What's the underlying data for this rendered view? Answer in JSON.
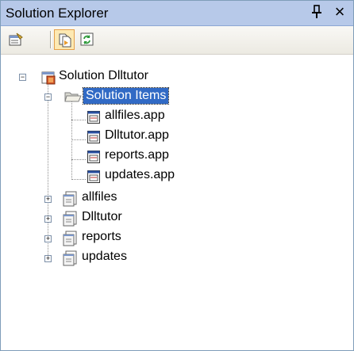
{
  "panel": {
    "title": "Solution Explorer",
    "pin_icon": "pin-icon",
    "close_icon": "close-icon",
    "close_glyph": "×",
    "pin_glyph": "ᵠ"
  },
  "toolbar": {
    "buttons": [
      {
        "name": "properties-button",
        "icon": "properties-icon",
        "pressed": false
      },
      {
        "name": "show-all-files-button",
        "icon": "show-all-files-icon",
        "pressed": true
      },
      {
        "name": "refresh-button",
        "icon": "refresh-icon",
        "pressed": false
      }
    ]
  },
  "tree": {
    "solution": {
      "label": "Solution Dlltutor",
      "expanded": true,
      "icon": "solution-icon"
    },
    "solution_items": {
      "label": "Solution Items",
      "expanded": true,
      "selected": true,
      "icon": "open-folder-icon",
      "children": [
        {
          "label": "allfiles.app",
          "icon": "app-file-icon"
        },
        {
          "label": "Dlltutor.app",
          "icon": "app-file-icon"
        },
        {
          "label": "reports.app",
          "icon": "app-file-icon"
        },
        {
          "label": "updates.app",
          "icon": "app-file-icon"
        }
      ]
    },
    "projects": [
      {
        "label": "allfiles",
        "expanded": false,
        "icon": "project-icon"
      },
      {
        "label": "Dlltutor",
        "expanded": false,
        "icon": "project-icon"
      },
      {
        "label": "reports",
        "expanded": false,
        "icon": "project-icon"
      },
      {
        "label": "updates",
        "expanded": false,
        "icon": "project-icon"
      }
    ]
  },
  "colors": {
    "titlebar": "#b7c9e9",
    "selection": "#316ac5",
    "toolbar_pressed": "#fde9b3"
  }
}
